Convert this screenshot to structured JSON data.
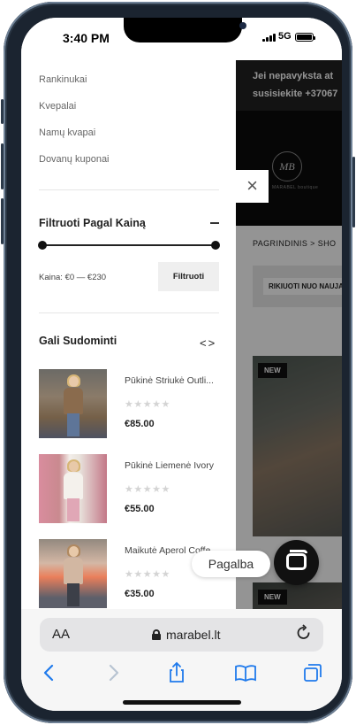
{
  "status_bar": {
    "time": "3:40 PM",
    "network": "5G"
  },
  "background_page": {
    "announcement": [
      "Jei nepavyksta at",
      "susisiekite +37067"
    ],
    "logo_text": "MB",
    "logo_sub": "MARABEL boutique",
    "breadcrumb": "PAGRINDINIS  >  SHO",
    "sort_button": "RIKIUOTI NUO NAUJA",
    "badge_new": "NEW",
    "badge_new2": "NEW"
  },
  "drawer": {
    "categories": [
      "Rankinukai",
      "Kvepalai",
      "Namų kvapai",
      "Dovanų kuponai"
    ],
    "price_filter": {
      "title": "Filtruoti Pagal Kainą",
      "price_label": "Kaina: €0 — €230",
      "button": "Filtruoti"
    },
    "recommend": {
      "title": "Gali Sudominti",
      "arrows": "<>",
      "products": [
        {
          "name": "Pūkinė Striukė Outli...",
          "stars": "★★★★★",
          "price": "€85.00"
        },
        {
          "name": "Pūkinė Liemenė Ivory",
          "stars": "★★★★★",
          "price": "€55.00"
        },
        {
          "name": "Maikutė Aperol Coffe",
          "stars": "★★★★★",
          "price": "€35.00"
        }
      ]
    }
  },
  "close_icon": "×",
  "chat": {
    "label": "Pagalba"
  },
  "safari": {
    "aa": "AA",
    "domain": "marabel.lt",
    "icons": [
      "reader-aa-icon",
      "lock-icon",
      "reload-icon",
      "back-icon",
      "forward-icon",
      "share-icon",
      "bookmarks-icon",
      "tabs-icon"
    ]
  },
  "colors": {
    "ios_blue": "#1f7aec",
    "dark": "#111111",
    "accent_gray": "#efefef"
  }
}
